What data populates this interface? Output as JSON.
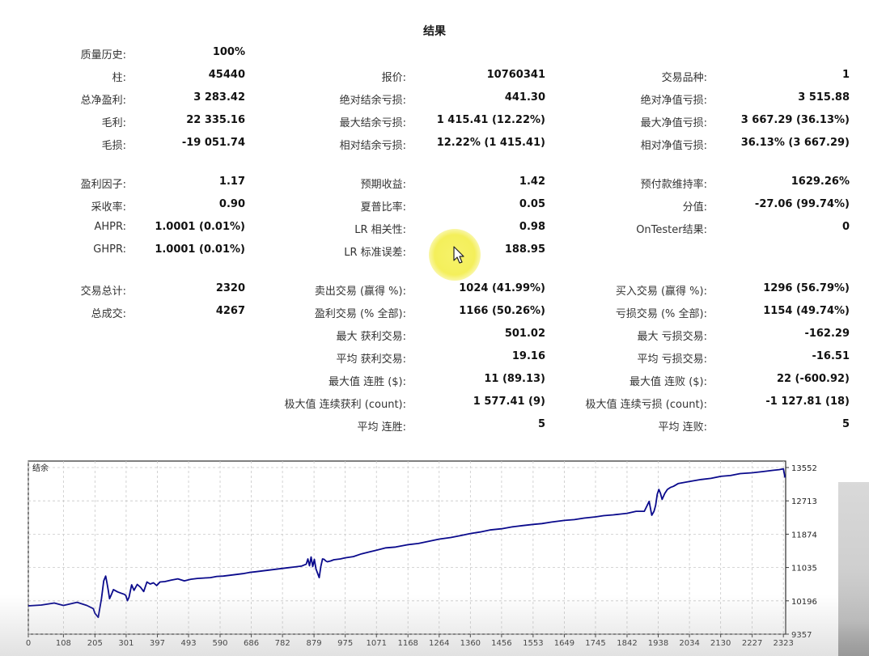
{
  "title": "结果",
  "stats": {
    "history_quality": {
      "label": "质量历史:",
      "value": "100%"
    },
    "bars": {
      "label": "柱:",
      "value": "45440"
    },
    "ticks": {
      "label": "报价:",
      "value": "10760341"
    },
    "symbols": {
      "label": "交易品种:",
      "value": "1"
    },
    "net_profit": {
      "label": "总净盈利:",
      "value": "3 283.42"
    },
    "abs_balance_dd": {
      "label": "绝对结余亏损:",
      "value": "441.30"
    },
    "abs_equity_dd": {
      "label": "绝对净值亏损:",
      "value": "3 515.88"
    },
    "gross_profit": {
      "label": "毛利:",
      "value": "22 335.16"
    },
    "max_balance_dd": {
      "label": "最大结余亏损:",
      "value": "1 415.41 (12.22%)"
    },
    "max_equity_dd": {
      "label": "最大净值亏损:",
      "value": "3 667.29 (36.13%)"
    },
    "gross_loss": {
      "label": "毛损:",
      "value": "-19 051.74"
    },
    "rel_balance_dd": {
      "label": "相对结余亏损:",
      "value": "12.22% (1 415.41)"
    },
    "rel_equity_dd": {
      "label": "相对净值亏损:",
      "value": "36.13% (3 667.29)"
    },
    "profit_factor": {
      "label": "盈利因子:",
      "value": "1.17"
    },
    "expected_payoff": {
      "label": "预期收益:",
      "value": "1.42"
    },
    "margin_level": {
      "label": "预付款维持率:",
      "value": "1629.26%"
    },
    "recovery_factor": {
      "label": "采收率:",
      "value": "0.90"
    },
    "sharpe_ratio": {
      "label": "夏普比率:",
      "value": "0.05"
    },
    "z_score": {
      "label": "分值:",
      "value": "-27.06 (99.74%)"
    },
    "ahpr": {
      "label": "AHPR:",
      "value": "1.0001 (0.01%)"
    },
    "lr_correlation": {
      "label": "LR 相关性:",
      "value": "0.98"
    },
    "ontester_result": {
      "label": "OnTester结果:",
      "value": "0"
    },
    "ghpr": {
      "label": "GHPR:",
      "value": "1.0001 (0.01%)"
    },
    "lr_std_error": {
      "label": "LR 标准误差:",
      "value": "188.95"
    },
    "total_trades": {
      "label": "交易总计:",
      "value": "2320"
    },
    "short_trades": {
      "label": "卖出交易 (赢得 %):",
      "value": "1024 (41.99%)"
    },
    "long_trades": {
      "label": "买入交易 (赢得 %):",
      "value": "1296 (56.79%)"
    },
    "total_deals": {
      "label": "总成交:",
      "value": "4267"
    },
    "profit_trades": {
      "label": "盈利交易 (% 全部):",
      "value": "1166 (50.26%)"
    },
    "loss_trades": {
      "label": "亏损交易 (% 全部):",
      "value": "1154 (49.74%)"
    },
    "largest_profit": {
      "label": "最大 获利交易:",
      "value": "501.02"
    },
    "largest_loss": {
      "label": "最大 亏损交易:",
      "value": "-162.29"
    },
    "avg_profit": {
      "label": "平均 获利交易:",
      "value": "19.16"
    },
    "avg_loss": {
      "label": "平均 亏损交易:",
      "value": "-16.51"
    },
    "max_consec_wins": {
      "label": "最大值 连胜 ($):",
      "value": "11 (89.13)"
    },
    "max_consec_losses": {
      "label": "最大值 连败 ($):",
      "value": "22 (-600.92)"
    },
    "max_consec_profit": {
      "label": "极大值 连续获利 (count):",
      "value": "1 577.41 (9)"
    },
    "max_consec_loss": {
      "label": "极大值 连续亏损 (count):",
      "value": "-1 127.81 (18)"
    },
    "avg_consec_wins": {
      "label": "平均 连胜:",
      "value": "5"
    },
    "avg_consec_losses": {
      "label": "平均 连败:",
      "value": "5"
    }
  },
  "chart_data": {
    "type": "line",
    "title": "结余",
    "xlabel": "",
    "ylabel": "",
    "x_ticks": [
      0,
      108,
      205,
      301,
      397,
      493,
      590,
      686,
      782,
      879,
      975,
      1071,
      1168,
      1264,
      1360,
      1456,
      1553,
      1649,
      1745,
      1842,
      1938,
      2034,
      2130,
      2227,
      2323
    ],
    "y_ticks": [
      9357,
      10196,
      11035,
      11874,
      12713,
      13552
    ],
    "xlim": [
      0,
      2330
    ],
    "ylim": [
      9357,
      13552
    ],
    "grid": true,
    "line_color": "#0a0a8c",
    "series": [
      {
        "name": "",
        "x": [
          0,
          40,
          80,
          108,
          150,
          180,
          200,
          205,
          215,
          225,
          232,
          238,
          242,
          246,
          250,
          256,
          262,
          268,
          275,
          285,
          295,
          300,
          305,
          310,
          318,
          325,
          335,
          345,
          355,
          365,
          375,
          385,
          395,
          405,
          420,
          440,
          460,
          480,
          500,
          520,
          540,
          560,
          580,
          600,
          620,
          640,
          660,
          680,
          700,
          720,
          740,
          760,
          780,
          800,
          820,
          840,
          855,
          860,
          865,
          870,
          875,
          880,
          885,
          895,
          900,
          905,
          910,
          915,
          920,
          930,
          940,
          960,
          975,
          1000,
          1025,
          1050,
          1071,
          1100,
          1130,
          1168,
          1200,
          1230,
          1264,
          1300,
          1330,
          1360,
          1390,
          1420,
          1456,
          1490,
          1520,
          1553,
          1580,
          1610,
          1649,
          1680,
          1710,
          1745,
          1770,
          1800,
          1820,
          1842,
          1870,
          1895,
          1910,
          1918,
          1925,
          1930,
          1935,
          1940,
          1945,
          1950,
          1958,
          1966,
          1975,
          1985,
          2000,
          2034,
          2070,
          2100,
          2130,
          2160,
          2190,
          2227,
          2260,
          2290,
          2310,
          2323,
          2328
        ],
        "y": [
          10070,
          10090,
          10140,
          10080,
          10160,
          10080,
          10000,
          9880,
          9780,
          10250,
          10700,
          10820,
          10650,
          10460,
          10250,
          10360,
          10480,
          10450,
          10420,
          10390,
          10360,
          10330,
          10200,
          10290,
          10600,
          10460,
          10610,
          10540,
          10430,
          10670,
          10620,
          10650,
          10580,
          10670,
          10680,
          10720,
          10750,
          10700,
          10740,
          10760,
          10770,
          10780,
          10810,
          10820,
          10840,
          10860,
          10880,
          10910,
          10930,
          10950,
          10970,
          10990,
          11010,
          11030,
          11050,
          11070,
          11120,
          11250,
          11080,
          11300,
          11060,
          11240,
          11000,
          10780,
          11060,
          11250,
          11240,
          11200,
          11180,
          11200,
          11230,
          11250,
          11280,
          11310,
          11380,
          11430,
          11470,
          11530,
          11550,
          11610,
          11640,
          11690,
          11750,
          11790,
          11840,
          11890,
          11930,
          11980,
          12010,
          12060,
          12090,
          12120,
          12140,
          12180,
          12220,
          12240,
          12280,
          12310,
          12340,
          12360,
          12380,
          12400,
          12450,
          12450,
          12700,
          12350,
          12450,
          12600,
          12880,
          13000,
          12900,
          12750,
          12900,
          13000,
          13050,
          13080,
          13150,
          13200,
          13250,
          13280,
          13330,
          13350,
          13400,
          13420,
          13450,
          13480,
          13500,
          13520,
          13300
        ]
      }
    ]
  }
}
